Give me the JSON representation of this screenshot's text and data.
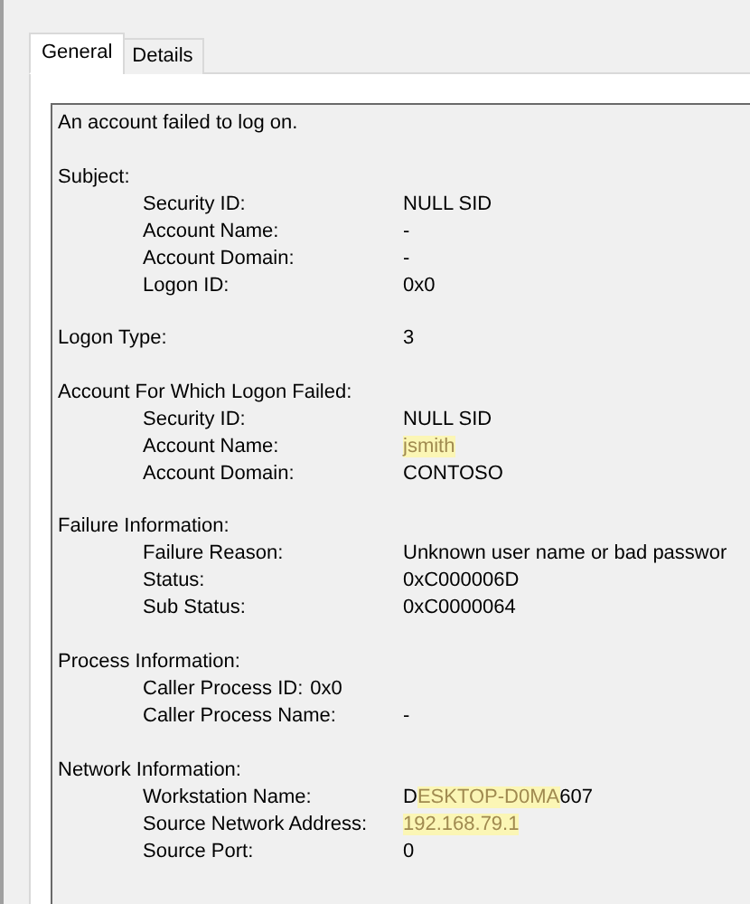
{
  "tabs": [
    {
      "label": "General",
      "selected": true
    },
    {
      "label": "Details",
      "selected": false
    }
  ],
  "description": {
    "intro": "An account failed to log on.",
    "sections": [
      {
        "kind": "group",
        "heading": "Subject:",
        "fields": [
          {
            "kind": "column",
            "label": "Security ID:",
            "value": "NULL SID"
          },
          {
            "kind": "column",
            "label": "Account Name:",
            "value": "-"
          },
          {
            "kind": "column",
            "label": "Account Domain:",
            "value": "-"
          },
          {
            "kind": "column",
            "label": "Logon ID:",
            "value": "0x0"
          }
        ]
      },
      {
        "kind": "field",
        "label": "Logon Type:",
        "value": "3"
      },
      {
        "kind": "group",
        "heading": "Account For Which Logon Failed:",
        "fields": [
          {
            "kind": "column",
            "label": "Security ID:",
            "value": "NULL SID"
          },
          {
            "kind": "column",
            "label": "Account Name:",
            "value_parts": [
              {
                "text": "jsmith",
                "highlighted": true
              }
            ]
          },
          {
            "kind": "column",
            "label": "Account Domain:",
            "value": "CONTOSO"
          }
        ]
      },
      {
        "kind": "group",
        "heading": "Failure Information:",
        "fields": [
          {
            "kind": "column",
            "label": "Failure Reason:",
            "value": "Unknown user name or bad passwor"
          },
          {
            "kind": "column",
            "label": "Status:",
            "value": "0xC000006D"
          },
          {
            "kind": "column",
            "label": "Sub Status:",
            "value": "0xC0000064"
          }
        ]
      },
      {
        "kind": "group",
        "heading": "Process Information:",
        "fields": [
          {
            "kind": "inline",
            "label": "Caller Process ID:",
            "value": "0x0"
          },
          {
            "kind": "column",
            "label": "Caller Process Name:",
            "value": "-"
          }
        ]
      },
      {
        "kind": "group",
        "heading": "Network Information:",
        "fields": [
          {
            "kind": "column",
            "label": "Workstation Name:",
            "value_parts": [
              {
                "text": "D",
                "highlighted": false
              },
              {
                "text": "ESKTOP-D0MA",
                "highlighted": true
              },
              {
                "text": "607",
                "highlighted": false
              }
            ]
          },
          {
            "kind": "column",
            "label": "Source Network Address:",
            "value_parts": [
              {
                "text": "192.168.79.1",
                "highlighted": true
              }
            ]
          },
          {
            "kind": "column",
            "label": "Source Port:",
            "value": "0"
          }
        ]
      }
    ]
  }
}
